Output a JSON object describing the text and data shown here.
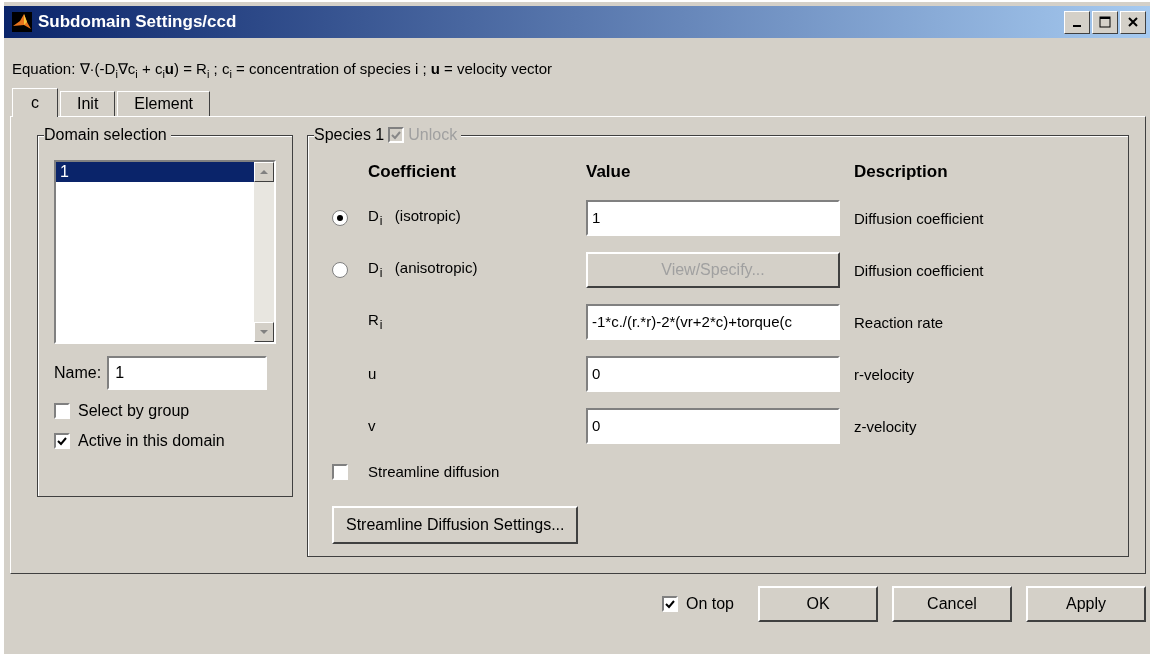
{
  "window": {
    "title": "Subdomain Settings/ccd"
  },
  "equation": "Equation: ∇·(-D$_{i}$∇c$_{i}$ + c$_{i}$**u**) = R$_{i}$ ;  c$_{i}$ = concentration of species i ;  **u** = velocity vector",
  "tabs": [
    {
      "label": "c",
      "selected": true
    },
    {
      "label": "Init",
      "selected": false
    },
    {
      "label": "Element",
      "selected": false
    }
  ],
  "domain_selection": {
    "title": "Domain selection",
    "items": [
      {
        "label": "1",
        "selected": true
      }
    ],
    "name_label": "Name:",
    "name_value": "1",
    "checkboxes": [
      {
        "label": "Select by group",
        "checked": false
      },
      {
        "label": "Active in this domain",
        "checked": true
      }
    ]
  },
  "species": {
    "title": "Species 1",
    "unlock": {
      "label": "Unlock",
      "checked": true,
      "disabled": true
    },
    "columns": [
      "Coefficient",
      "Value",
      "Description"
    ],
    "rows": [
      {
        "kind": "radio",
        "selected": true,
        "coefficient": "D$_{i}$  (isotropic)",
        "value": "1",
        "description": "Diffusion coefficient"
      },
      {
        "kind": "radio",
        "selected": false,
        "coefficient": "D$_{i}$  (anisotropic)",
        "button": "View/Specify...",
        "description": "Diffusion coefficient"
      },
      {
        "kind": "plain",
        "coefficient": "R$_{i}$",
        "value": "-1*c./(r.*r)-2*(vr+2*c)+torque(c",
        "description": "Reaction rate"
      },
      {
        "kind": "plain",
        "coefficient": "u",
        "value": "0",
        "description": "r-velocity"
      },
      {
        "kind": "plain",
        "coefficient": "v",
        "value": "0",
        "description": "z-velocity"
      },
      {
        "kind": "checkbox",
        "checked": false,
        "coefficient": "Streamline diffusion"
      }
    ],
    "settings_button": "Streamline Diffusion Settings..."
  },
  "footer": {
    "on_top": {
      "label": "On top",
      "checked": true
    },
    "buttons": [
      "OK",
      "Cancel",
      "Apply"
    ]
  }
}
